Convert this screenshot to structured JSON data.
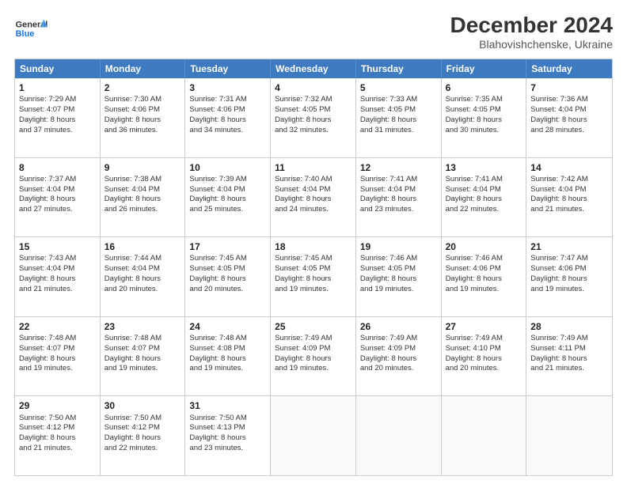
{
  "app": {
    "logo_line1": "General",
    "logo_line2": "Blue"
  },
  "title": "December 2024",
  "subtitle": "Blahovishchenske, Ukraine",
  "days": [
    "Sunday",
    "Monday",
    "Tuesday",
    "Wednesday",
    "Thursday",
    "Friday",
    "Saturday"
  ],
  "weeks": [
    [
      {
        "num": "1",
        "lines": [
          "Sunrise: 7:29 AM",
          "Sunset: 4:07 PM",
          "Daylight: 8 hours",
          "and 37 minutes."
        ]
      },
      {
        "num": "2",
        "lines": [
          "Sunrise: 7:30 AM",
          "Sunset: 4:06 PM",
          "Daylight: 8 hours",
          "and 36 minutes."
        ]
      },
      {
        "num": "3",
        "lines": [
          "Sunrise: 7:31 AM",
          "Sunset: 4:06 PM",
          "Daylight: 8 hours",
          "and 34 minutes."
        ]
      },
      {
        "num": "4",
        "lines": [
          "Sunrise: 7:32 AM",
          "Sunset: 4:05 PM",
          "Daylight: 8 hours",
          "and 32 minutes."
        ]
      },
      {
        "num": "5",
        "lines": [
          "Sunrise: 7:33 AM",
          "Sunset: 4:05 PM",
          "Daylight: 8 hours",
          "and 31 minutes."
        ]
      },
      {
        "num": "6",
        "lines": [
          "Sunrise: 7:35 AM",
          "Sunset: 4:05 PM",
          "Daylight: 8 hours",
          "and 30 minutes."
        ]
      },
      {
        "num": "7",
        "lines": [
          "Sunrise: 7:36 AM",
          "Sunset: 4:04 PM",
          "Daylight: 8 hours",
          "and 28 minutes."
        ]
      }
    ],
    [
      {
        "num": "8",
        "lines": [
          "Sunrise: 7:37 AM",
          "Sunset: 4:04 PM",
          "Daylight: 8 hours",
          "and 27 minutes."
        ]
      },
      {
        "num": "9",
        "lines": [
          "Sunrise: 7:38 AM",
          "Sunset: 4:04 PM",
          "Daylight: 8 hours",
          "and 26 minutes."
        ]
      },
      {
        "num": "10",
        "lines": [
          "Sunrise: 7:39 AM",
          "Sunset: 4:04 PM",
          "Daylight: 8 hours",
          "and 25 minutes."
        ]
      },
      {
        "num": "11",
        "lines": [
          "Sunrise: 7:40 AM",
          "Sunset: 4:04 PM",
          "Daylight: 8 hours",
          "and 24 minutes."
        ]
      },
      {
        "num": "12",
        "lines": [
          "Sunrise: 7:41 AM",
          "Sunset: 4:04 PM",
          "Daylight: 8 hours",
          "and 23 minutes."
        ]
      },
      {
        "num": "13",
        "lines": [
          "Sunrise: 7:41 AM",
          "Sunset: 4:04 PM",
          "Daylight: 8 hours",
          "and 22 minutes."
        ]
      },
      {
        "num": "14",
        "lines": [
          "Sunrise: 7:42 AM",
          "Sunset: 4:04 PM",
          "Daylight: 8 hours",
          "and 21 minutes."
        ]
      }
    ],
    [
      {
        "num": "15",
        "lines": [
          "Sunrise: 7:43 AM",
          "Sunset: 4:04 PM",
          "Daylight: 8 hours",
          "and 21 minutes."
        ]
      },
      {
        "num": "16",
        "lines": [
          "Sunrise: 7:44 AM",
          "Sunset: 4:04 PM",
          "Daylight: 8 hours",
          "and 20 minutes."
        ]
      },
      {
        "num": "17",
        "lines": [
          "Sunrise: 7:45 AM",
          "Sunset: 4:05 PM",
          "Daylight: 8 hours",
          "and 20 minutes."
        ]
      },
      {
        "num": "18",
        "lines": [
          "Sunrise: 7:45 AM",
          "Sunset: 4:05 PM",
          "Daylight: 8 hours",
          "and 19 minutes."
        ]
      },
      {
        "num": "19",
        "lines": [
          "Sunrise: 7:46 AM",
          "Sunset: 4:05 PM",
          "Daylight: 8 hours",
          "and 19 minutes."
        ]
      },
      {
        "num": "20",
        "lines": [
          "Sunrise: 7:46 AM",
          "Sunset: 4:06 PM",
          "Daylight: 8 hours",
          "and 19 minutes."
        ]
      },
      {
        "num": "21",
        "lines": [
          "Sunrise: 7:47 AM",
          "Sunset: 4:06 PM",
          "Daylight: 8 hours",
          "and 19 minutes."
        ]
      }
    ],
    [
      {
        "num": "22",
        "lines": [
          "Sunrise: 7:48 AM",
          "Sunset: 4:07 PM",
          "Daylight: 8 hours",
          "and 19 minutes."
        ]
      },
      {
        "num": "23",
        "lines": [
          "Sunrise: 7:48 AM",
          "Sunset: 4:07 PM",
          "Daylight: 8 hours",
          "and 19 minutes."
        ]
      },
      {
        "num": "24",
        "lines": [
          "Sunrise: 7:48 AM",
          "Sunset: 4:08 PM",
          "Daylight: 8 hours",
          "and 19 minutes."
        ]
      },
      {
        "num": "25",
        "lines": [
          "Sunrise: 7:49 AM",
          "Sunset: 4:09 PM",
          "Daylight: 8 hours",
          "and 19 minutes."
        ]
      },
      {
        "num": "26",
        "lines": [
          "Sunrise: 7:49 AM",
          "Sunset: 4:09 PM",
          "Daylight: 8 hours",
          "and 20 minutes."
        ]
      },
      {
        "num": "27",
        "lines": [
          "Sunrise: 7:49 AM",
          "Sunset: 4:10 PM",
          "Daylight: 8 hours",
          "and 20 minutes."
        ]
      },
      {
        "num": "28",
        "lines": [
          "Sunrise: 7:49 AM",
          "Sunset: 4:11 PM",
          "Daylight: 8 hours",
          "and 21 minutes."
        ]
      }
    ],
    [
      {
        "num": "29",
        "lines": [
          "Sunrise: 7:50 AM",
          "Sunset: 4:12 PM",
          "Daylight: 8 hours",
          "and 21 minutes."
        ]
      },
      {
        "num": "30",
        "lines": [
          "Sunrise: 7:50 AM",
          "Sunset: 4:12 PM",
          "Daylight: 8 hours",
          "and 22 minutes."
        ]
      },
      {
        "num": "31",
        "lines": [
          "Sunrise: 7:50 AM",
          "Sunset: 4:13 PM",
          "Daylight: 8 hours",
          "and 23 minutes."
        ]
      },
      null,
      null,
      null,
      null
    ]
  ]
}
